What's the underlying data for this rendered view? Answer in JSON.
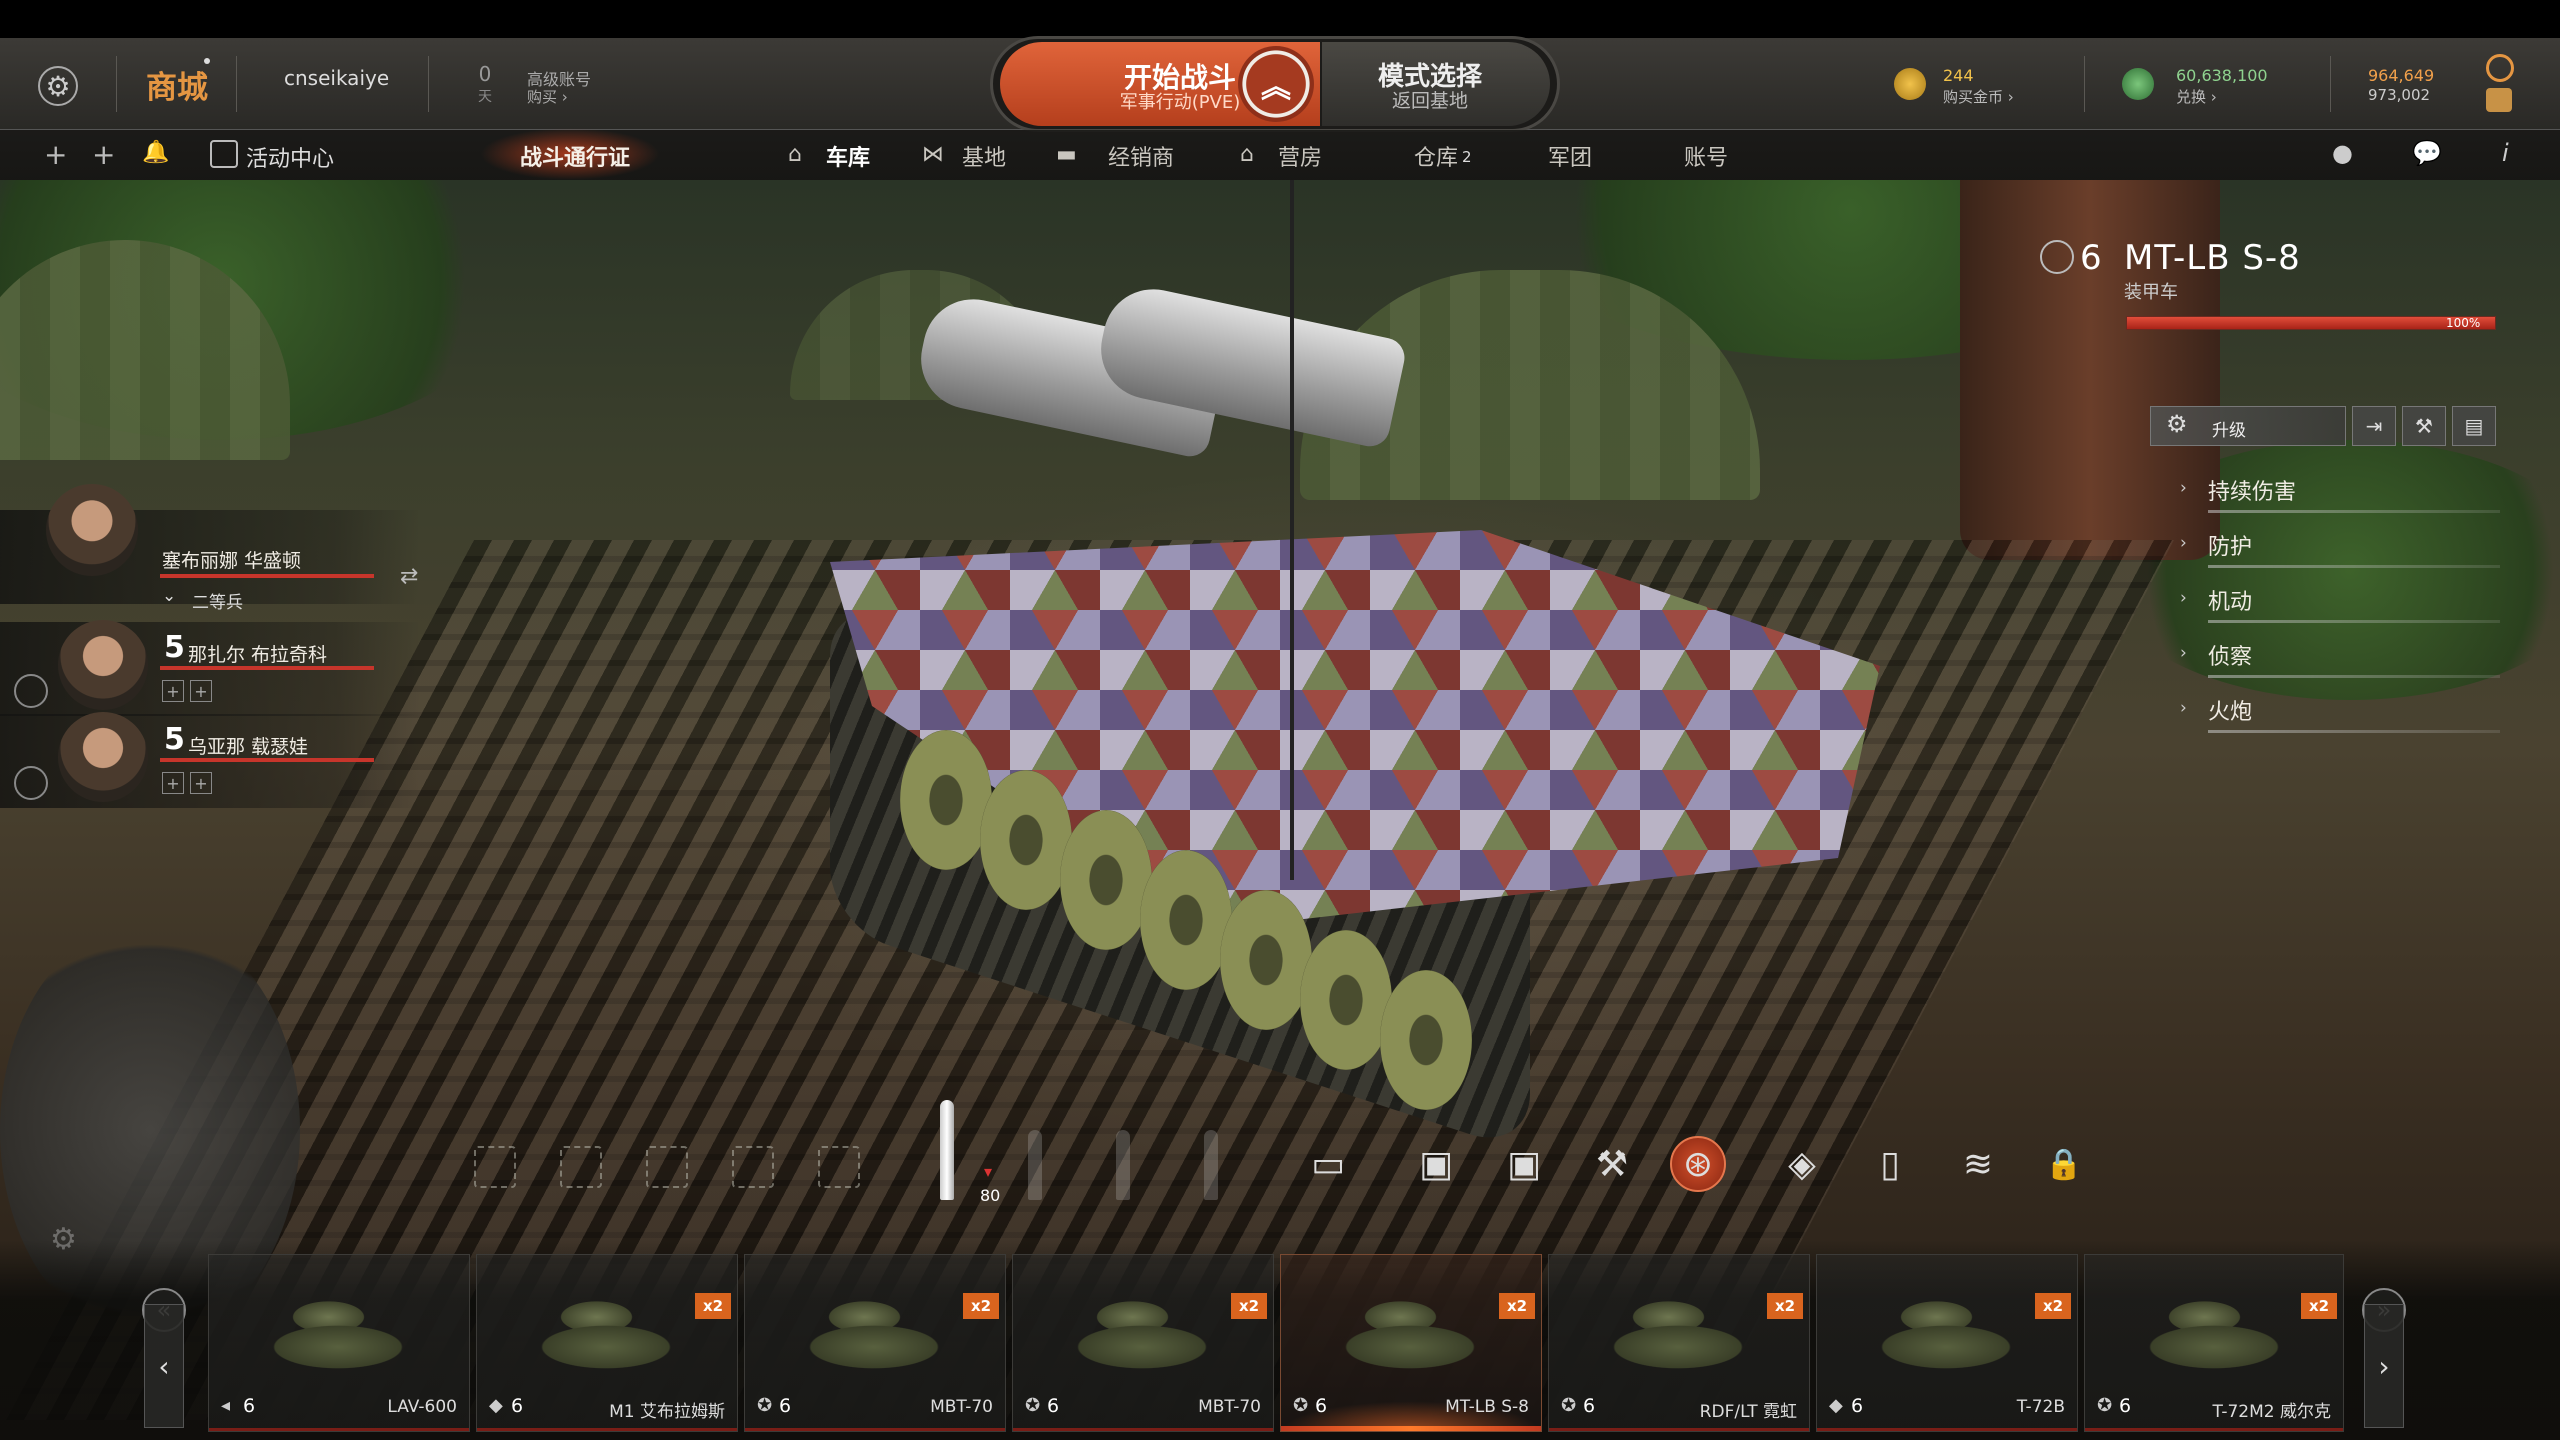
{
  "topbar": {
    "shop_label": "商城",
    "username": "cnseikaiye",
    "premium_days": "0",
    "premium_days_unit": "天",
    "premium_title": "高级账号",
    "premium_buy": "购买 ›",
    "start_battle": "开始战斗",
    "start_battle_mode": "军事行动(PVE)",
    "mode_select": "模式选择",
    "mode_select_sub": "返回基地",
    "gold_value": "244",
    "gold_sub": "购买金币 ›",
    "silver_value": "60,638,100",
    "silver_sub": "兑换 ›",
    "xp_value": "964,649",
    "xp_sub": "973,002"
  },
  "nav": {
    "event_center": "活动中心",
    "battle_pass": "战斗通行证",
    "tabs": [
      {
        "label": "车库",
        "icon": "home-icon",
        "active": true
      },
      {
        "label": "基地",
        "icon": "network-icon"
      },
      {
        "label": "经销商",
        "icon": "tank-icon"
      },
      {
        "label": "营房",
        "icon": "barracks-icon"
      },
      {
        "label": "仓库",
        "count": "2"
      },
      {
        "label": "军团"
      },
      {
        "label": "账号"
      }
    ]
  },
  "crew": [
    {
      "name": "塞布丽娜 华盛顿",
      "rank": "二等兵",
      "level": ""
    },
    {
      "name": "那扎尔 布拉奇科",
      "level": "5"
    },
    {
      "name": "乌亚那 载瑟娃",
      "level": "5"
    }
  ],
  "vehicle": {
    "tier": "6",
    "name": "MT-LB S-8",
    "type": "装甲车",
    "hp_percent": 100,
    "hp_text": "100%",
    "upgrade_label": "升级",
    "stats": [
      "持续伤害",
      "防护",
      "机动",
      "侦察",
      "火炮"
    ]
  },
  "ammo": {
    "count": "80"
  },
  "carousel": [
    {
      "tier": "6",
      "name": "LAV-600",
      "multiplier": "",
      "tier_icon": "diamond-icon"
    },
    {
      "tier": "6",
      "name": "M1 艾布拉姆斯",
      "multiplier": "x2",
      "tier_icon": "diamond-icon"
    },
    {
      "tier": "6",
      "name": "MBT-70",
      "multiplier": "x2",
      "tier_icon": "star-icon"
    },
    {
      "tier": "6",
      "name": "MBT-70",
      "multiplier": "x2",
      "tier_icon": "star-icon"
    },
    {
      "tier": "6",
      "name": "MT-LB S-8",
      "multiplier": "x2",
      "tier_icon": "star-icon",
      "active": true
    },
    {
      "tier": "6",
      "name": "RDF/LT 霓虹",
      "multiplier": "x2",
      "tier_icon": "star-icon"
    },
    {
      "tier": "6",
      "name": "T-72B",
      "multiplier": "x2",
      "tier_icon": "diamond-icon"
    },
    {
      "tier": "6",
      "name": "T-72M2 威尔克",
      "multiplier": "x2",
      "tier_icon": "star-icon"
    }
  ],
  "colors": {
    "accent": "#e05a2e",
    "gold": "#f1c24b",
    "silver": "#8fd38f",
    "hp": "#c7352b"
  }
}
